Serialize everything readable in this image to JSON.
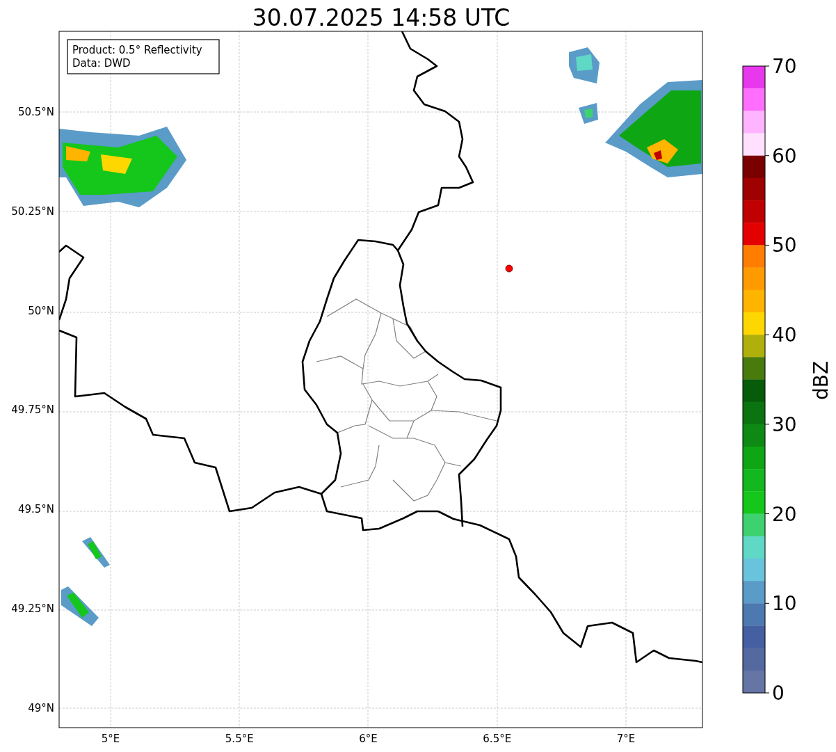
{
  "title": "30.07.2025 14:58 UTC",
  "legend": [
    "Product: 0.5° Reflectivity",
    "Data: DWD"
  ],
  "map": {
    "lat_labels": [
      "50.5°N",
      "50.25°N",
      "50°N",
      "49.75°N",
      "49.5°N",
      "49.25°N",
      "49°N"
    ],
    "lon_labels": [
      "5°E",
      "5.5°E",
      "6°E",
      "6.5°E",
      "7°E"
    ]
  },
  "colorbar": {
    "label": "dBZ",
    "ticks": [
      "70",
      "60",
      "50",
      "40",
      "30",
      "20",
      "10",
      "0"
    ],
    "bins": [
      {
        "color": "#e838ee"
      },
      {
        "color": "#ff6eff"
      },
      {
        "color": "#ffb4ff"
      },
      {
        "color": "#ffe0ff"
      },
      {
        "color": "#7a0000"
      },
      {
        "color": "#9f0000"
      },
      {
        "color": "#c00000"
      },
      {
        "color": "#e50000"
      },
      {
        "color": "#ff7d00"
      },
      {
        "color": "#ff9b00"
      },
      {
        "color": "#ffb400"
      },
      {
        "color": "#ffd700"
      },
      {
        "color": "#b0b00c"
      },
      {
        "color": "#487a0c"
      },
      {
        "color": "#075c0a"
      },
      {
        "color": "#0b7410"
      },
      {
        "color": "#0e8a14"
      },
      {
        "color": "#0fa613"
      },
      {
        "color": "#12b81d"
      },
      {
        "color": "#14c71a"
      },
      {
        "color": "#3dd26f"
      },
      {
        "color": "#5fd8c6"
      },
      {
        "color": "#68c4dc"
      },
      {
        "color": "#5a9bc8"
      },
      {
        "color": "#4c7ab0"
      },
      {
        "color": "#4560a2"
      },
      {
        "color": "#5469a0"
      },
      {
        "color": "#6475a6"
      }
    ]
  }
}
